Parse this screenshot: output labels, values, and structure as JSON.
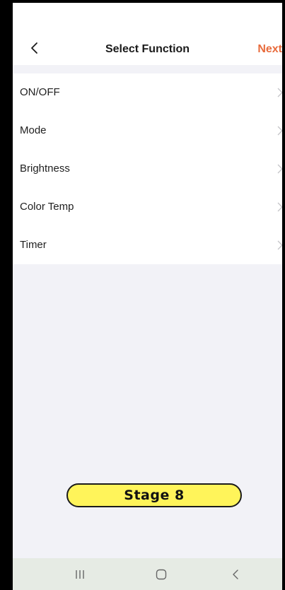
{
  "header": {
    "title": "Select Function",
    "next_label": "Next",
    "back_icon": "chevron-left-icon"
  },
  "functions": [
    {
      "label": "ON/OFF"
    },
    {
      "label": "Mode"
    },
    {
      "label": "Brightness"
    },
    {
      "label": "Color Temp"
    },
    {
      "label": "Timer"
    }
  ],
  "stage_badge": {
    "label": "Stage 8",
    "fill_color": "#fff45a"
  },
  "system_nav": {
    "recent_icon": "recent-apps-icon",
    "home_icon": "home-icon",
    "back_icon": "back-icon"
  },
  "colors": {
    "accent": "#e86b3c",
    "background": "#f2f2f7",
    "nav_bar": "#e6ebe4"
  }
}
